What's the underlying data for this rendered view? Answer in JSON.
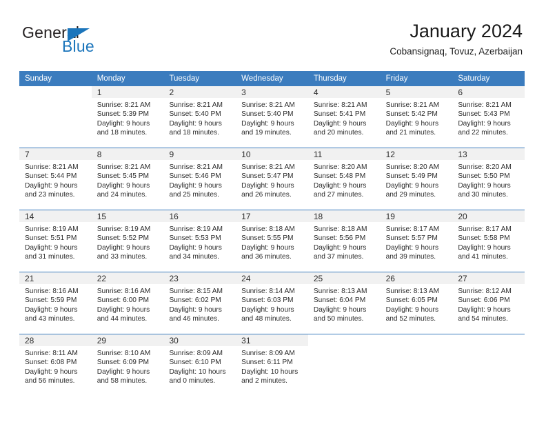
{
  "brand": {
    "name_part1": "General",
    "name_part2": "Blue",
    "logo_icon": "triangle-flag-icon"
  },
  "header": {
    "title": "January 2024",
    "subtitle": "Cobansignaq, Tovuz, Azerbaijan"
  },
  "colors": {
    "header_blue": "#3b7cbe",
    "brand_blue": "#1b75bb",
    "daynum_band": "#f1f1f1",
    "text": "#2b2b2b",
    "page_background": "#ffffff"
  },
  "calendar": {
    "weekday_headers": [
      "Sunday",
      "Monday",
      "Tuesday",
      "Wednesday",
      "Thursday",
      "Friday",
      "Saturday"
    ],
    "weeks": [
      [
        {
          "day": "",
          "lines": []
        },
        {
          "day": "1",
          "lines": [
            "Sunrise: 8:21 AM",
            "Sunset: 5:39 PM",
            "Daylight: 9 hours",
            "and 18 minutes."
          ]
        },
        {
          "day": "2",
          "lines": [
            "Sunrise: 8:21 AM",
            "Sunset: 5:40 PM",
            "Daylight: 9 hours",
            "and 18 minutes."
          ]
        },
        {
          "day": "3",
          "lines": [
            "Sunrise: 8:21 AM",
            "Sunset: 5:40 PM",
            "Daylight: 9 hours",
            "and 19 minutes."
          ]
        },
        {
          "day": "4",
          "lines": [
            "Sunrise: 8:21 AM",
            "Sunset: 5:41 PM",
            "Daylight: 9 hours",
            "and 20 minutes."
          ]
        },
        {
          "day": "5",
          "lines": [
            "Sunrise: 8:21 AM",
            "Sunset: 5:42 PM",
            "Daylight: 9 hours",
            "and 21 minutes."
          ]
        },
        {
          "day": "6",
          "lines": [
            "Sunrise: 8:21 AM",
            "Sunset: 5:43 PM",
            "Daylight: 9 hours",
            "and 22 minutes."
          ]
        }
      ],
      [
        {
          "day": "7",
          "lines": [
            "Sunrise: 8:21 AM",
            "Sunset: 5:44 PM",
            "Daylight: 9 hours",
            "and 23 minutes."
          ]
        },
        {
          "day": "8",
          "lines": [
            "Sunrise: 8:21 AM",
            "Sunset: 5:45 PM",
            "Daylight: 9 hours",
            "and 24 minutes."
          ]
        },
        {
          "day": "9",
          "lines": [
            "Sunrise: 8:21 AM",
            "Sunset: 5:46 PM",
            "Daylight: 9 hours",
            "and 25 minutes."
          ]
        },
        {
          "day": "10",
          "lines": [
            "Sunrise: 8:21 AM",
            "Sunset: 5:47 PM",
            "Daylight: 9 hours",
            "and 26 minutes."
          ]
        },
        {
          "day": "11",
          "lines": [
            "Sunrise: 8:20 AM",
            "Sunset: 5:48 PM",
            "Daylight: 9 hours",
            "and 27 minutes."
          ]
        },
        {
          "day": "12",
          "lines": [
            "Sunrise: 8:20 AM",
            "Sunset: 5:49 PM",
            "Daylight: 9 hours",
            "and 29 minutes."
          ]
        },
        {
          "day": "13",
          "lines": [
            "Sunrise: 8:20 AM",
            "Sunset: 5:50 PM",
            "Daylight: 9 hours",
            "and 30 minutes."
          ]
        }
      ],
      [
        {
          "day": "14",
          "lines": [
            "Sunrise: 8:19 AM",
            "Sunset: 5:51 PM",
            "Daylight: 9 hours",
            "and 31 minutes."
          ]
        },
        {
          "day": "15",
          "lines": [
            "Sunrise: 8:19 AM",
            "Sunset: 5:52 PM",
            "Daylight: 9 hours",
            "and 33 minutes."
          ]
        },
        {
          "day": "16",
          "lines": [
            "Sunrise: 8:19 AM",
            "Sunset: 5:53 PM",
            "Daylight: 9 hours",
            "and 34 minutes."
          ]
        },
        {
          "day": "17",
          "lines": [
            "Sunrise: 8:18 AM",
            "Sunset: 5:55 PM",
            "Daylight: 9 hours",
            "and 36 minutes."
          ]
        },
        {
          "day": "18",
          "lines": [
            "Sunrise: 8:18 AM",
            "Sunset: 5:56 PM",
            "Daylight: 9 hours",
            "and 37 minutes."
          ]
        },
        {
          "day": "19",
          "lines": [
            "Sunrise: 8:17 AM",
            "Sunset: 5:57 PM",
            "Daylight: 9 hours",
            "and 39 minutes."
          ]
        },
        {
          "day": "20",
          "lines": [
            "Sunrise: 8:17 AM",
            "Sunset: 5:58 PM",
            "Daylight: 9 hours",
            "and 41 minutes."
          ]
        }
      ],
      [
        {
          "day": "21",
          "lines": [
            "Sunrise: 8:16 AM",
            "Sunset: 5:59 PM",
            "Daylight: 9 hours",
            "and 43 minutes."
          ]
        },
        {
          "day": "22",
          "lines": [
            "Sunrise: 8:16 AM",
            "Sunset: 6:00 PM",
            "Daylight: 9 hours",
            "and 44 minutes."
          ]
        },
        {
          "day": "23",
          "lines": [
            "Sunrise: 8:15 AM",
            "Sunset: 6:02 PM",
            "Daylight: 9 hours",
            "and 46 minutes."
          ]
        },
        {
          "day": "24",
          "lines": [
            "Sunrise: 8:14 AM",
            "Sunset: 6:03 PM",
            "Daylight: 9 hours",
            "and 48 minutes."
          ]
        },
        {
          "day": "25",
          "lines": [
            "Sunrise: 8:13 AM",
            "Sunset: 6:04 PM",
            "Daylight: 9 hours",
            "and 50 minutes."
          ]
        },
        {
          "day": "26",
          "lines": [
            "Sunrise: 8:13 AM",
            "Sunset: 6:05 PM",
            "Daylight: 9 hours",
            "and 52 minutes."
          ]
        },
        {
          "day": "27",
          "lines": [
            "Sunrise: 8:12 AM",
            "Sunset: 6:06 PM",
            "Daylight: 9 hours",
            "and 54 minutes."
          ]
        }
      ],
      [
        {
          "day": "28",
          "lines": [
            "Sunrise: 8:11 AM",
            "Sunset: 6:08 PM",
            "Daylight: 9 hours",
            "and 56 minutes."
          ]
        },
        {
          "day": "29",
          "lines": [
            "Sunrise: 8:10 AM",
            "Sunset: 6:09 PM",
            "Daylight: 9 hours",
            "and 58 minutes."
          ]
        },
        {
          "day": "30",
          "lines": [
            "Sunrise: 8:09 AM",
            "Sunset: 6:10 PM",
            "Daylight: 10 hours",
            "and 0 minutes."
          ]
        },
        {
          "day": "31",
          "lines": [
            "Sunrise: 8:09 AM",
            "Sunset: 6:11 PM",
            "Daylight: 10 hours",
            "and 2 minutes."
          ]
        },
        {
          "day": "",
          "lines": []
        },
        {
          "day": "",
          "lines": []
        },
        {
          "day": "",
          "lines": []
        }
      ]
    ]
  }
}
